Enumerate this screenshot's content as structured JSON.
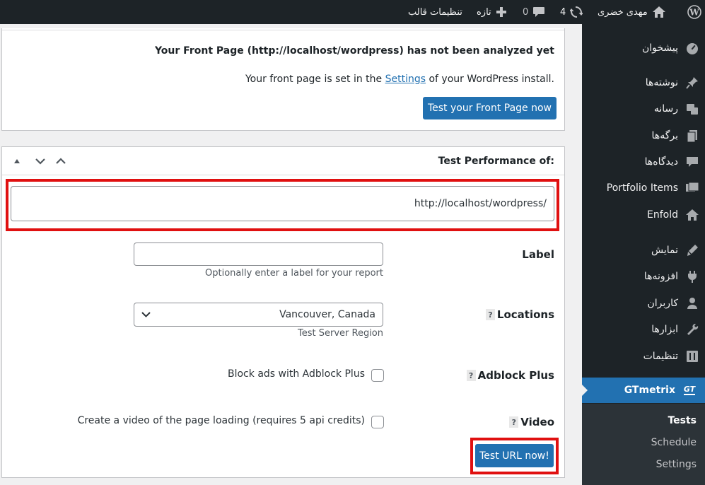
{
  "adminbar": {
    "site_name": "مهدی خضری",
    "updates_count": "4",
    "comments_count": "0",
    "new_label": "تازه",
    "customize_label": "تنظیمات قالب"
  },
  "sidebar": {
    "items": [
      {
        "label": "پیشخوان",
        "icon": "dashboard-icon"
      },
      {
        "label": "نوشته‌ها",
        "icon": "pin-icon"
      },
      {
        "label": "رسانه",
        "icon": "media-icon"
      },
      {
        "label": "برگه‌ها",
        "icon": "pages-icon"
      },
      {
        "label": "دیدگاه‌ها",
        "icon": "comments-icon"
      },
      {
        "label": "Portfolio Items",
        "icon": "portfolio-icon"
      },
      {
        "label": "Enfold",
        "icon": "home-icon"
      },
      {
        "label": "نمایش",
        "icon": "appearance-icon"
      },
      {
        "label": "افزونه‌ها",
        "icon": "plugins-icon"
      },
      {
        "label": "کاربران",
        "icon": "users-icon"
      },
      {
        "label": "ابزارها",
        "icon": "tools-icon"
      },
      {
        "label": "تنظیمات",
        "icon": "settings-icon"
      }
    ],
    "current": {
      "label": "GTmetrix",
      "icon_text": "GT"
    },
    "submenu": [
      "Tests",
      "Schedule",
      "Settings"
    ]
  },
  "front_page": {
    "heading": "Your Front Page (http://localhost/wordpress) has not been analyzed yet",
    "text_before": "Your front page is set in the ",
    "settings_link": "Settings",
    "text_after": " of your WordPress install.",
    "button": "Test your Front Page now"
  },
  "perf": {
    "title": "Test Performance of:",
    "url_value": "http://localhost/wordpress/",
    "label_field": {
      "label": "Label",
      "value": "",
      "desc": "Optionally enter a label for your report"
    },
    "locations": {
      "label": "Locations",
      "help": "?",
      "selected": "Vancouver, Canada",
      "desc": "Test Server Region"
    },
    "adblock": {
      "label": "Adblock Plus",
      "help": "?",
      "checkbox_label": "Block ads with Adblock Plus",
      "checked": false
    },
    "video": {
      "label": "Video",
      "help": "?",
      "checkbox_label": "Create a video of the page loading (requires 5 api credits)",
      "checked": false
    },
    "submit": "Test URL now!"
  },
  "colors": {
    "accent": "#2271b1",
    "highlight": "#e01010",
    "adminbar": "#1d2327"
  }
}
